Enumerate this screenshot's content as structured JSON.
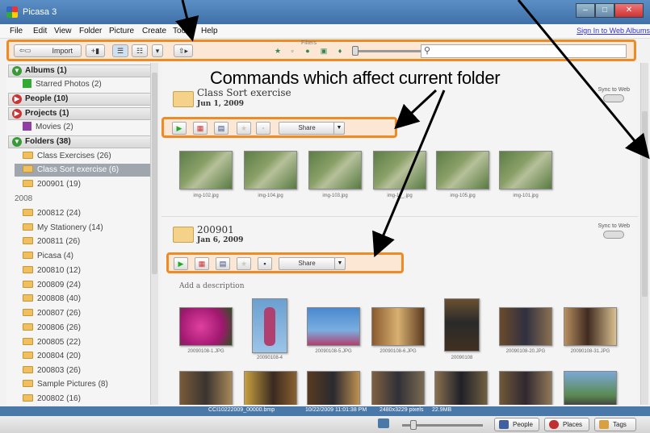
{
  "window": {
    "title": "Picasa 3",
    "minimize": "–",
    "maximize": "□",
    "close": "✕"
  },
  "menu": {
    "items": [
      "File",
      "Edit",
      "View",
      "Folder",
      "Picture",
      "Create",
      "Tools",
      "Help"
    ],
    "sign_in": "Sign In to Web Albums"
  },
  "toolbar": {
    "import_label": "Import",
    "filters_label": "Filters",
    "search_placeholder": ""
  },
  "annotation": {
    "text": "Commands which affect current folder"
  },
  "sidebar": {
    "albums": "Albums (1)",
    "starred": "Starred Photos (2)",
    "people": "People (10)",
    "projects": "Projects (1)",
    "movies": "Movies (2)",
    "folders": "Folders (38)",
    "folder_items_top": [
      "Class Exercises (26)",
      "Class Sort exercise (6)",
      "200901 (19)"
    ],
    "year": "2008",
    "folder_items_2008": [
      "200812 (24)",
      "My Stationery (14)",
      "200811 (26)",
      "Picasa (4)",
      "200810 (12)",
      "200809 (24)",
      "200808 (40)",
      "200807 (26)",
      "200806 (26)",
      "200805 (22)",
      "200804 (20)",
      "200803 (26)",
      "Sample Pictures (8)",
      "200802 (16)"
    ]
  },
  "folder1": {
    "title": "Class Sort exercise",
    "date": "Jun 1, 2009",
    "sync_label": "Sync to Web",
    "share_label": "Share",
    "captions": [
      "img-102.jpg",
      "img-104.jpg",
      "img-103.jpg",
      "img-1__.jpg",
      "img-105.jpg",
      "img-101.jpg"
    ]
  },
  "folder2": {
    "title": "200901",
    "date": "Jan 6, 2009",
    "sync_label": "Sync to Web",
    "share_label": "Share",
    "description_placeholder": "Add a description",
    "captions": [
      "20090108-1.JPG",
      "20090108-4",
      "20090108-5.JPG",
      "20090108-6.JPG",
      "20090108",
      "20090108-20.JPG",
      "20090108-31.JPG"
    ]
  },
  "status": {
    "file": "CCI10222009_00000.bmp",
    "date": "10/22/2009 11:01:38 PM",
    "size": "2480x3229 pixels",
    "mb": "22.9MB"
  },
  "bottom": {
    "people_label": "People",
    "places_label": "Places",
    "tags_label": "Tags"
  },
  "colors": {
    "highlight_border": "#f08a24",
    "highlight_fill": "#fbe7d3",
    "status_bar": "#4a78a8"
  }
}
